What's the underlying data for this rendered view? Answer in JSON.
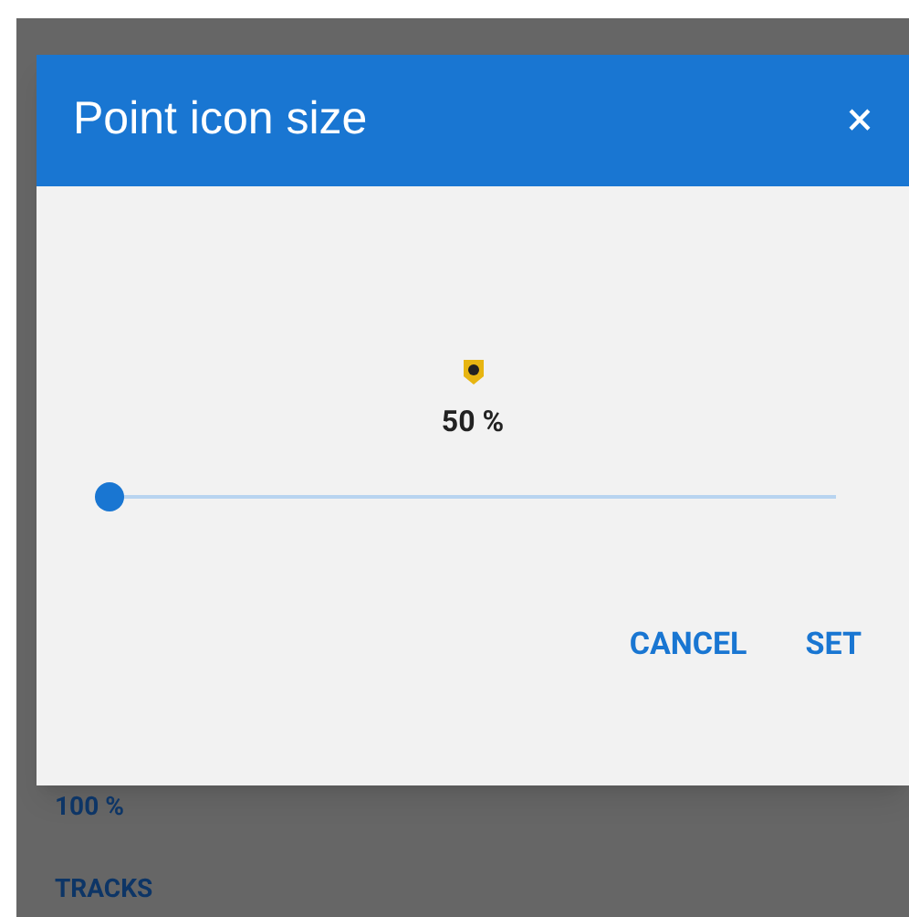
{
  "dialog": {
    "title": "Point icon size",
    "close": "×",
    "value": "50 %",
    "slider": {
      "level": 0
    },
    "buttons": [
      "CANCEL",
      "SET"
    ]
  },
  "background": {
    "items": [
      "100 %",
      "TRACKS"
    ]
  }
}
